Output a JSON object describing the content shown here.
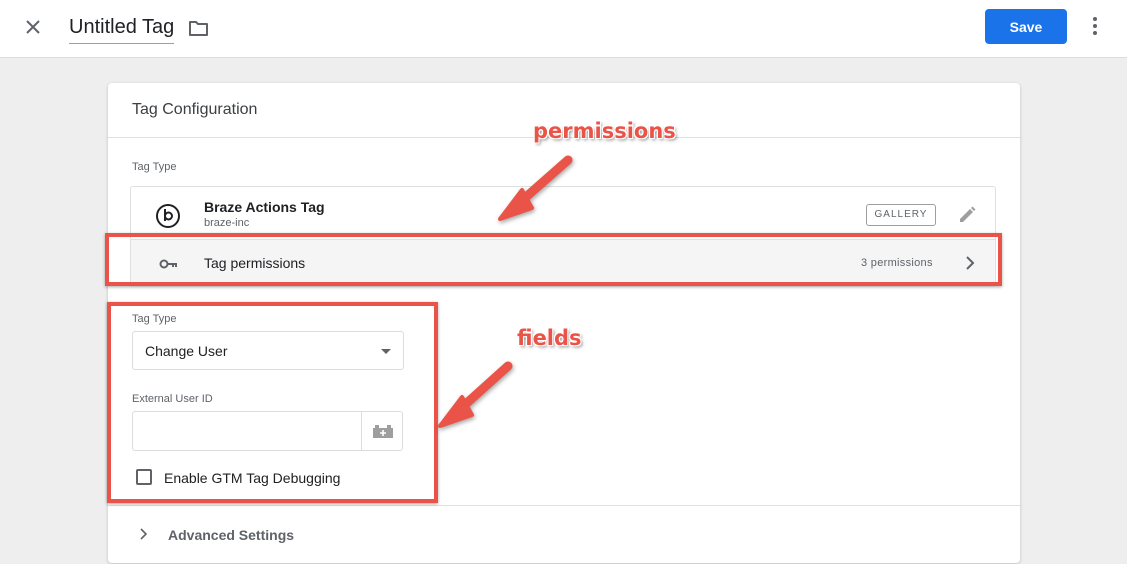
{
  "header": {
    "title": "Untitled Tag",
    "save_label": "Save",
    "icons": {
      "close": "close-icon",
      "folder": "folder-icon",
      "more": "more-vert-icon"
    }
  },
  "card": {
    "title": "Tag Configuration",
    "tag_type_label": "Tag Type",
    "tag_type": {
      "name": "Braze Actions Tag",
      "owner": "braze-inc",
      "gallery_label": "GALLERY",
      "icon": "braze-logo-icon"
    },
    "permissions": {
      "label": "Tag permissions",
      "count": "3 permissions",
      "icon": "key-icon"
    },
    "fields": {
      "select_label": "Tag Type",
      "select_value": "Change User",
      "input_label": "External User ID",
      "input_value": "",
      "checkbox_label": "Enable GTM Tag Debugging",
      "checkbox_checked": false
    },
    "advanced_label": "Advanced Settings"
  },
  "annotations": {
    "permissions_label": "permissions",
    "fields_label": "fields",
    "color": "#ea5348"
  },
  "colors": {
    "primary": "#1a73e8",
    "annotation": "#ea5348"
  }
}
